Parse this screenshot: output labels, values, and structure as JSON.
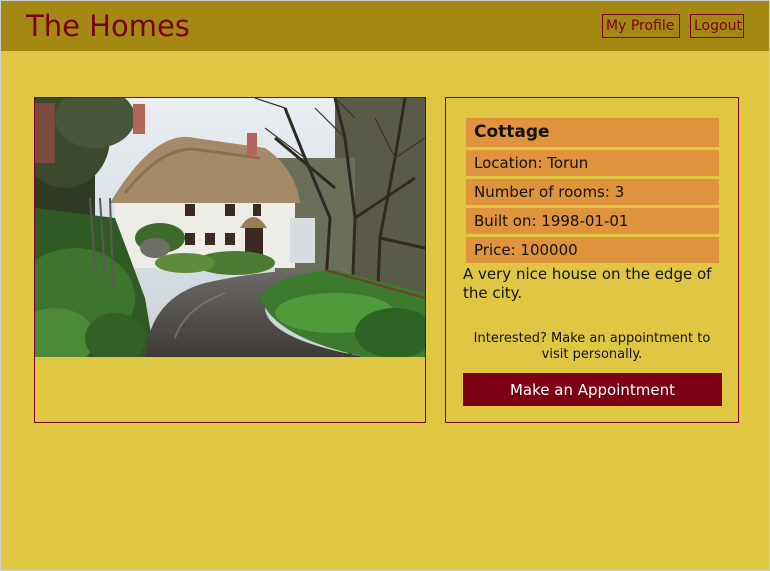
{
  "header": {
    "site_title": "The Homes",
    "nav": {
      "profile_label": "My Profile",
      "logout_label": "Logout"
    }
  },
  "listing": {
    "title": "Cottage",
    "location": "Location: Torun",
    "rooms": "Number of rooms: 3",
    "built_on": "Built on: 1998-01-01",
    "price": "Price: 100000",
    "description": "A very nice house on the edge of the city.",
    "cta_text": "Interested? Make an appointment to visit personally.",
    "cta_button": "Make an Appointment"
  },
  "colors": {
    "page_bg": "#dfc744",
    "header_bg": "#a38914",
    "accent": "#7b0014",
    "info_row_bg": "#de933c"
  }
}
